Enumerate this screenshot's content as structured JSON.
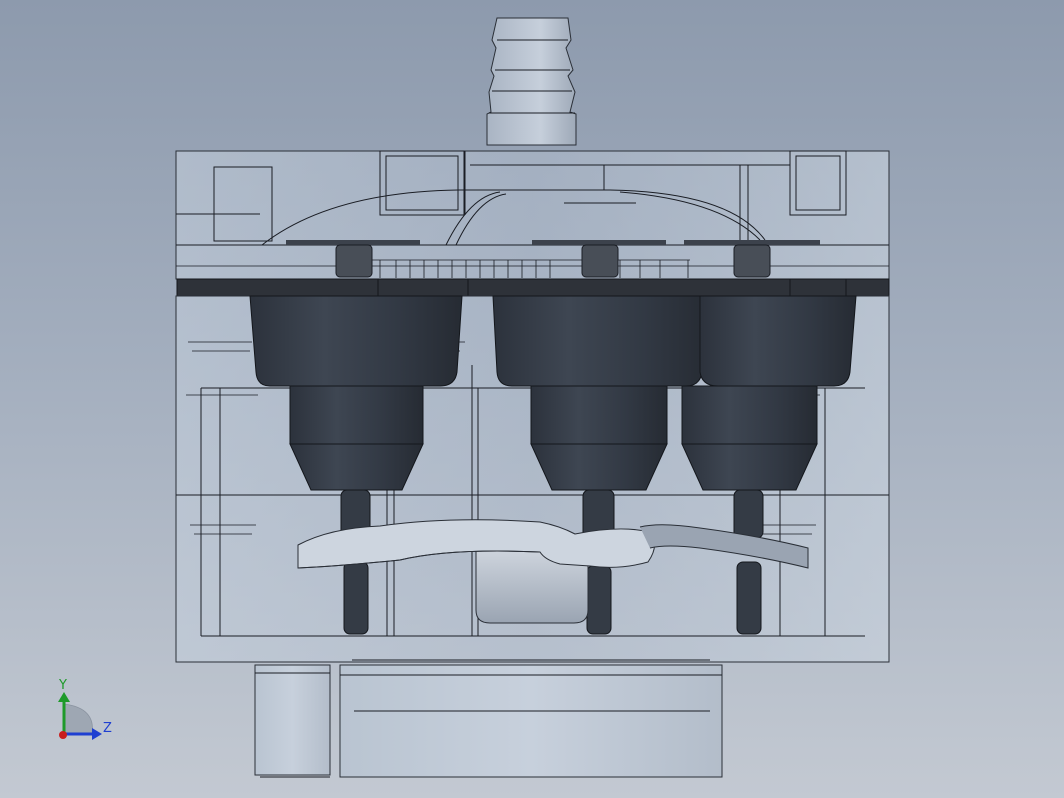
{
  "viewport": {
    "background_top": "#8d9aad",
    "background_bottom": "#c3c9d2"
  },
  "triad": {
    "y_label": "Y",
    "z_label": "Z",
    "y_color": "#1e9a2a",
    "z_color": "#1f3fd1",
    "x_color": "#c81e1e"
  },
  "model": {
    "transparent_body_color": "#b7c3d2",
    "dark_part_color": "#353c47",
    "line_color": "#1a1d24"
  }
}
